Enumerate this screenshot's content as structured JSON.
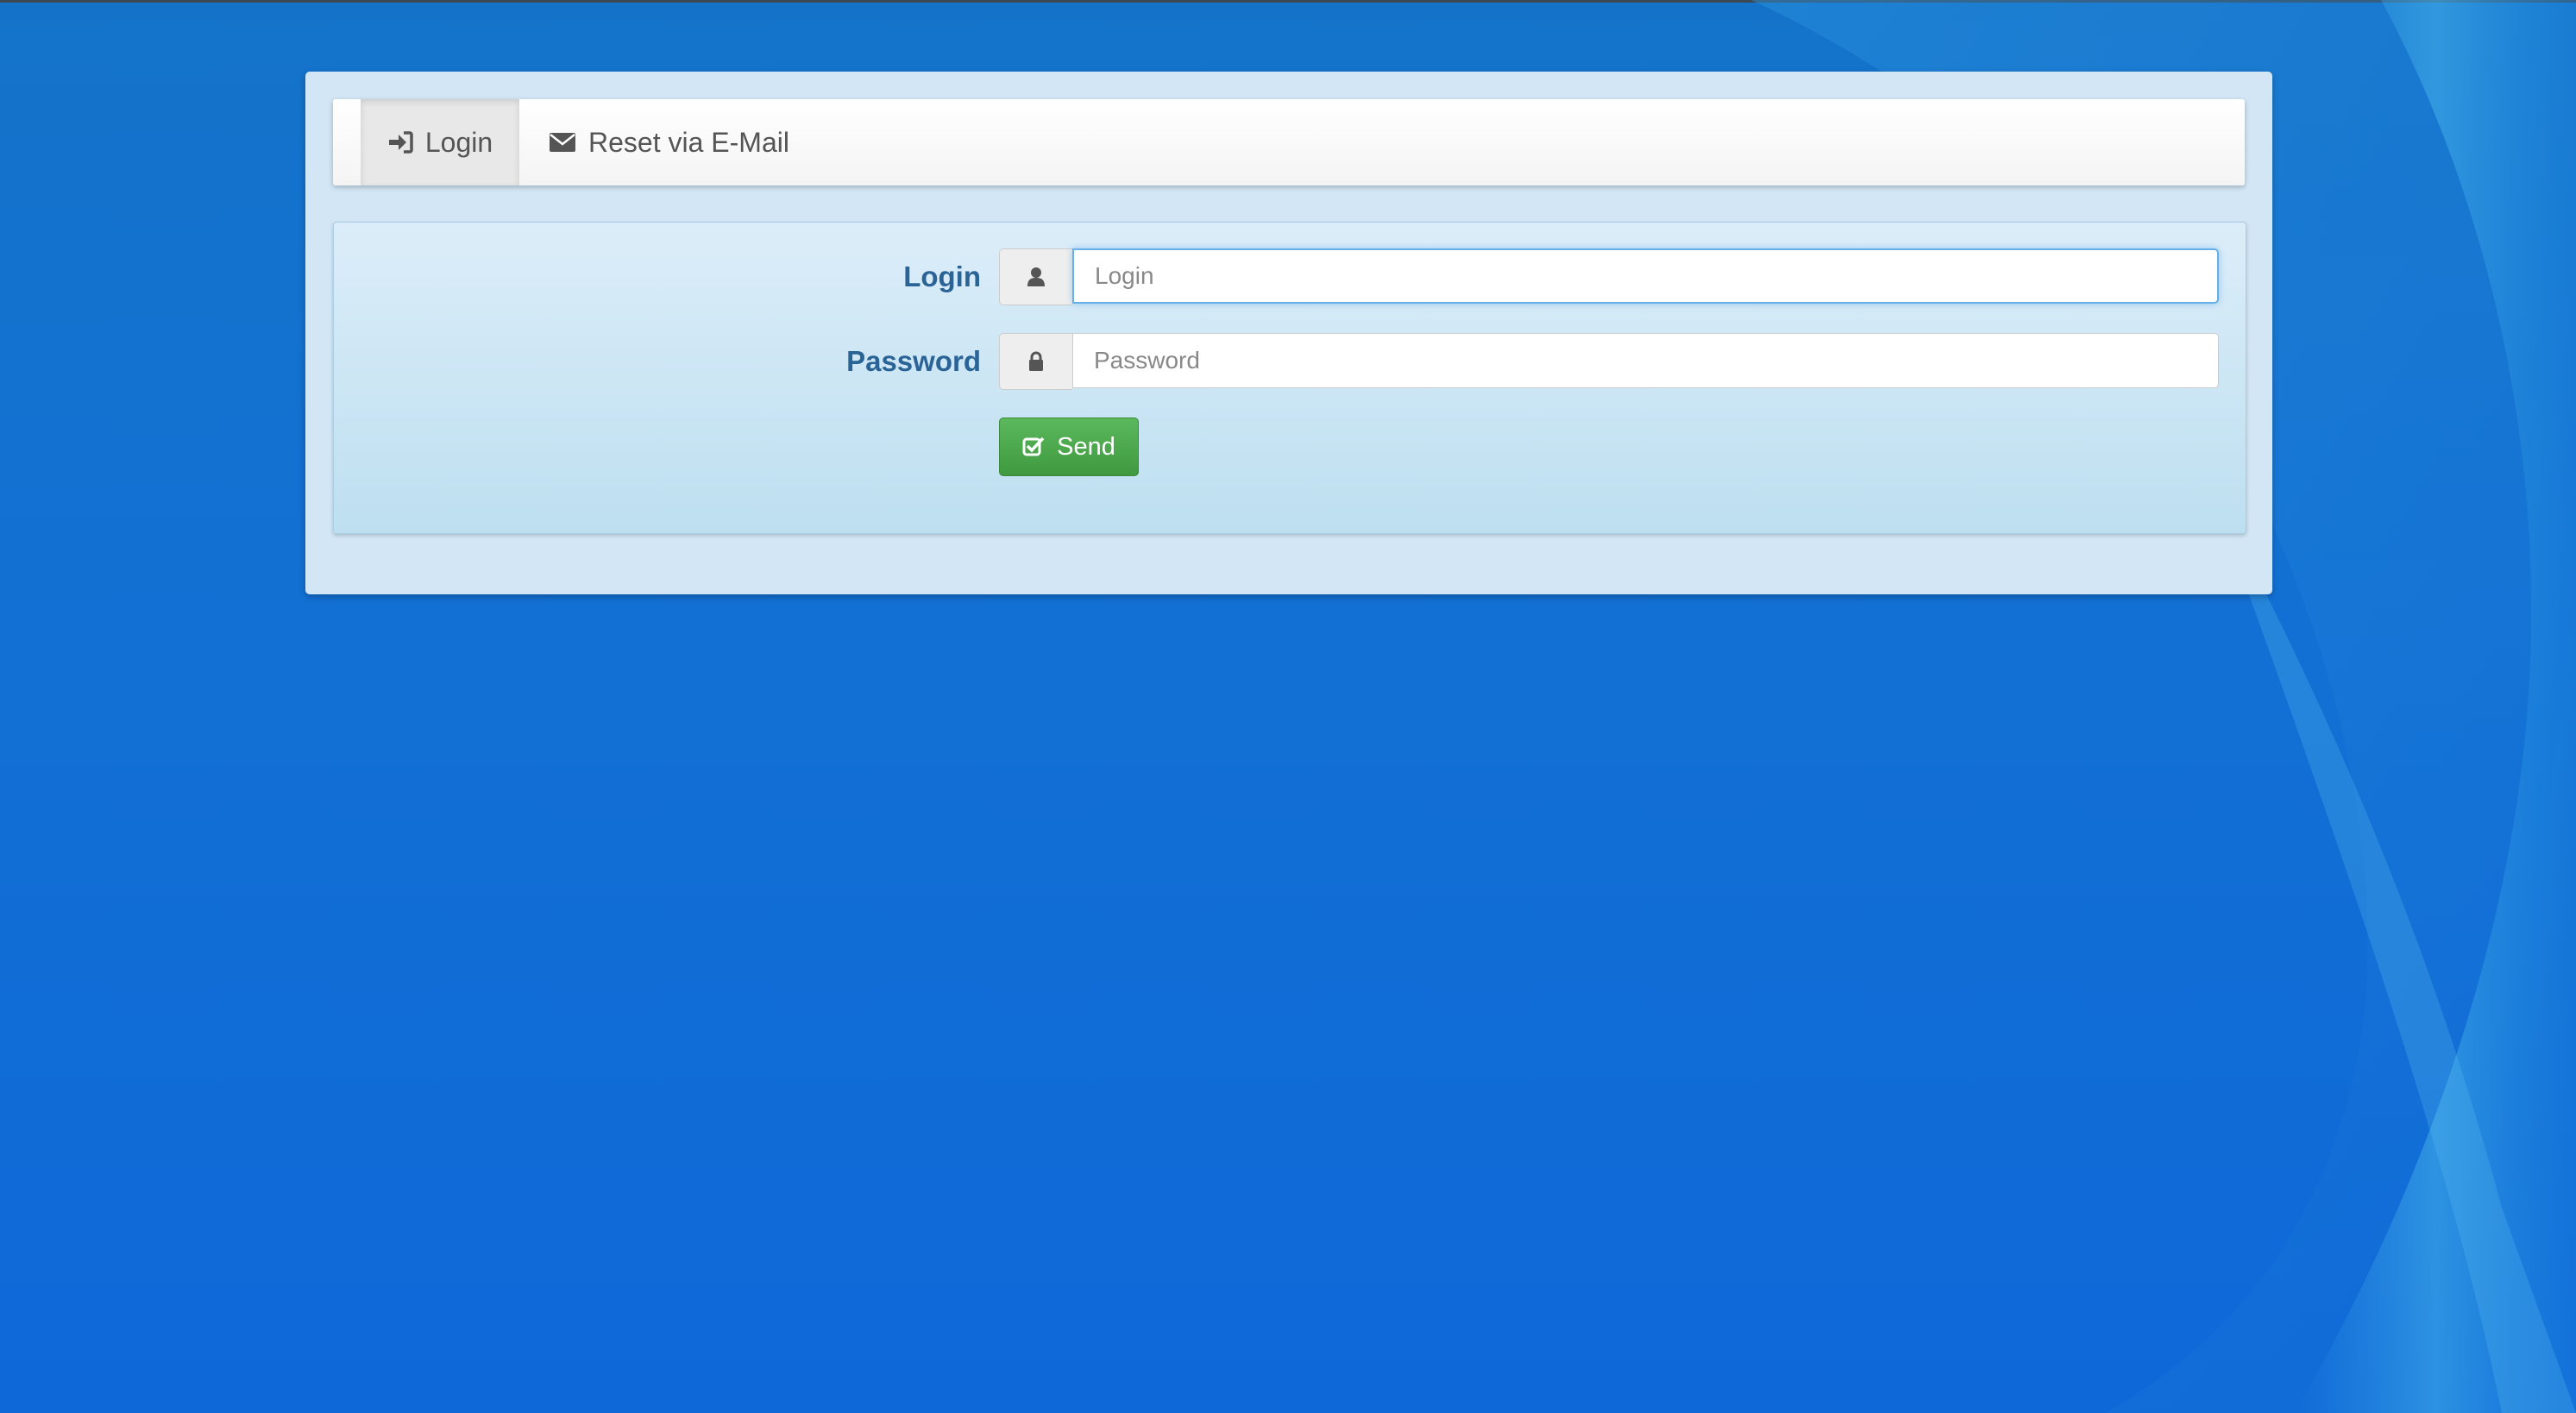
{
  "tabs": {
    "login": {
      "label": "Login",
      "icon": "sign-in-icon",
      "active": true
    },
    "reset": {
      "label": "Reset via E-Mail",
      "icon": "envelope-icon",
      "active": false
    }
  },
  "form": {
    "login_label": "Login",
    "login_placeholder": "Login",
    "login_value": "",
    "password_label": "Password",
    "password_placeholder": "Password",
    "password_value": "",
    "submit_label": "Send",
    "submit_icon": "check-square-icon"
  },
  "colors": {
    "label_blue": "#2a6496",
    "send_green": "#4cae4c",
    "desktop_blue": "#1170d6"
  }
}
